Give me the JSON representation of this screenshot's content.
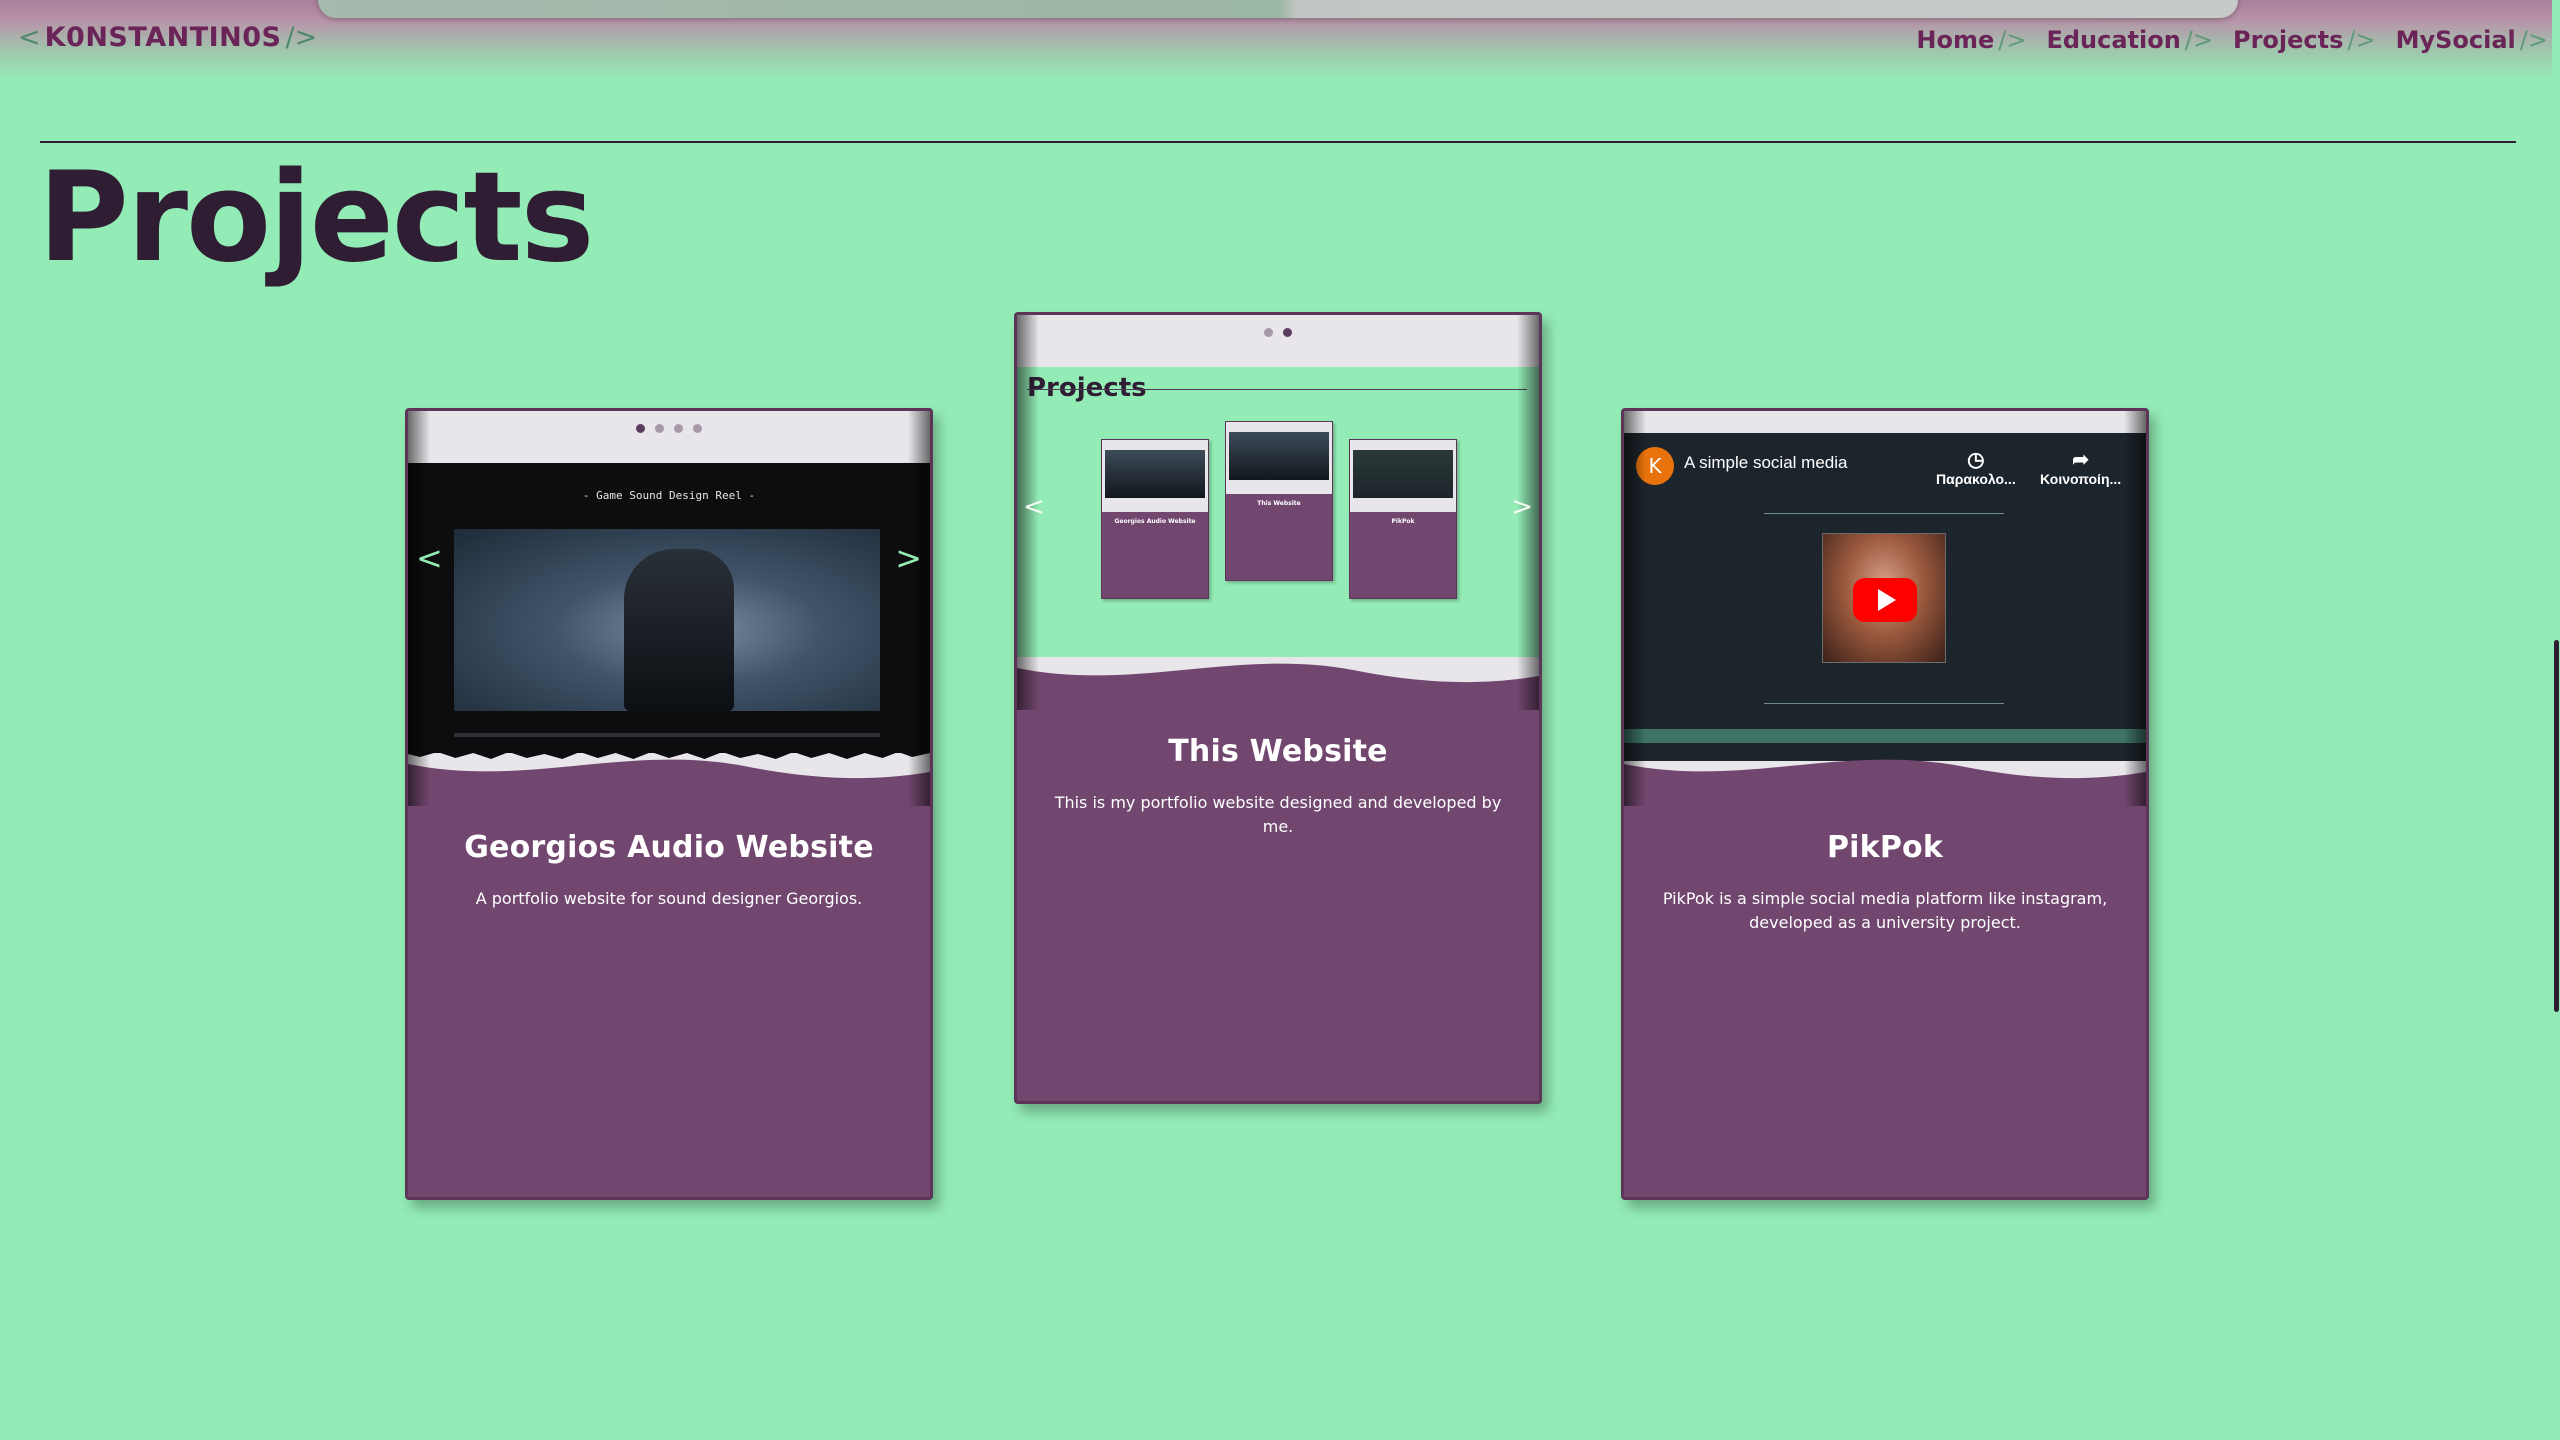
{
  "header": {
    "brand": {
      "open": "<",
      "name": "K0NSTANTIN0S",
      "close": "/>"
    },
    "nav": [
      {
        "label": "Home",
        "sep": "/>"
      },
      {
        "label": "Education",
        "sep": "/>"
      },
      {
        "label": "Projects",
        "sep": "/>"
      },
      {
        "label": "MySocial",
        "sep": "/>"
      }
    ]
  },
  "page": {
    "title": "Projects"
  },
  "cards": [
    {
      "title": "Georgios Audio Website",
      "description": "A portfolio website for sound designer Georgios.",
      "preview": {
        "dots": 4,
        "active_dot": 1,
        "screen_title": "- Game Sound Design Reel -",
        "arrow_left": "<",
        "arrow_right": ">"
      }
    },
    {
      "title": "This Website",
      "description": "This is my portfolio website designed and developed by me.",
      "preview": {
        "dots": 2,
        "active_dot": 2,
        "heading": "Projects",
        "mini_cards": [
          "Georgios Audio Website",
          "This Website",
          "PikPok"
        ],
        "arrow_left": "<",
        "arrow_right": ">"
      }
    },
    {
      "title": "PikPok",
      "description": "PikPok is a simple social media platform like instagram, developed as a university project.",
      "preview": {
        "avatar_letter": "K",
        "video_title": "A simple social media",
        "action_watch": "Παρακολο...",
        "action_share": "Κοινοποίη..."
      }
    }
  ],
  "colors": {
    "background": "#93ecb5",
    "card": "#72476f",
    "brand": "#6b2458",
    "text_dark": "#2f1d33"
  },
  "icons": [
    "clock-icon",
    "share-icon",
    "play-icon",
    "chevron-left-icon",
    "chevron-right-icon"
  ]
}
